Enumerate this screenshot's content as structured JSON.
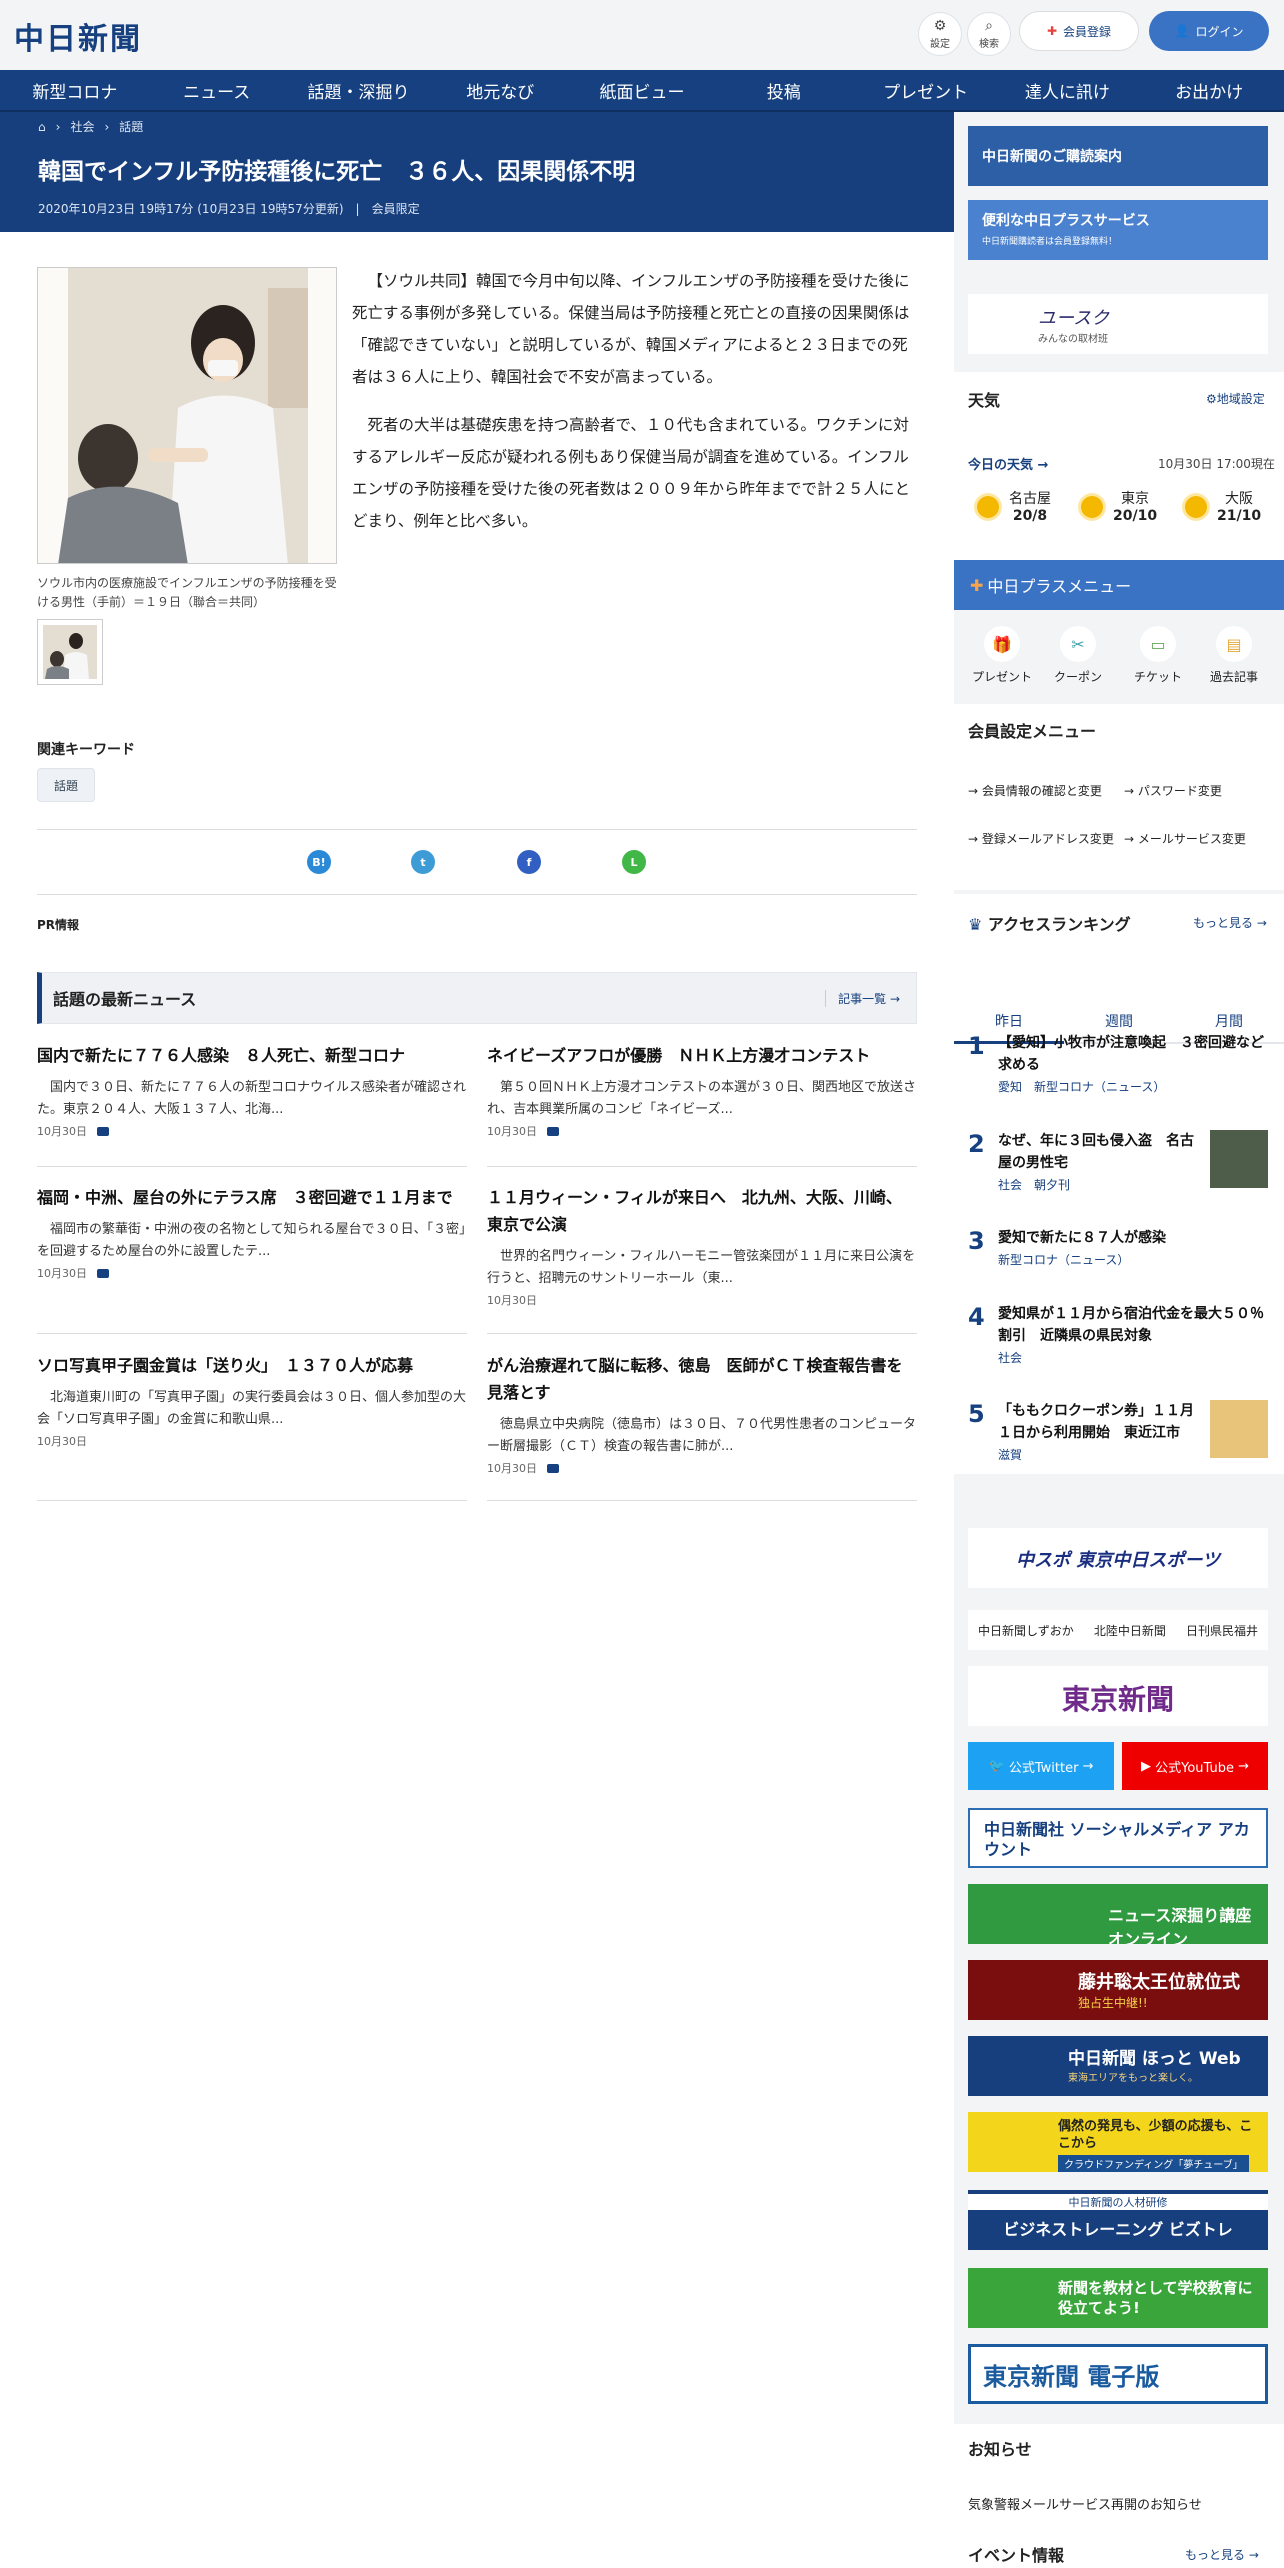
{
  "header": {
    "logo": "中日新聞",
    "settings_label": "設定",
    "search_label": "検索",
    "register_label": "会員登録",
    "login_label": "ログイン"
  },
  "nav": [
    "新型コロナ",
    "ニュース",
    "話題・深掘り",
    "地元なび",
    "紙面ビュー",
    "投稿",
    "プレゼント",
    "達人に訊け",
    "お出かけ"
  ],
  "breadcrumb": [
    "社会",
    "話題"
  ],
  "article": {
    "title": "韓国でインフル予防接種後に死亡　３６人、因果関係不明",
    "date": "2020年10月23日 19時17分 (10月23日 19時57分更新)",
    "member": "会員限定",
    "caption": "ソウル市内の医療施設でインフルエンザの予防接種を受ける男性（手前）＝１９日（聯合＝共同）",
    "p1": "【ソウル共同】韓国で今月中旬以降、インフルエンザの予防接種を受けた後に死亡する事例が多発している。保健当局は予防接種と死亡との直接の因果関係は「確認できていない」と説明しているが、韓国メディアによると２３日までの死者は３６人に上り、韓国社会で不安が高まっている。",
    "p2": "死者の大半は基礎疾患を持つ高齢者で、１０代も含まれている。ワクチンに対するアレルギー反応が疑われる例もあり保健当局が調査を進めている。インフルエンザの予防接種を受けた後の死者数は２００９年から昨年までで計２５人にとどまり、例年と比べ多い。",
    "keyword_heading": "関連キーワード",
    "keyword": "話題",
    "pr": "PR情報"
  },
  "latest": {
    "heading": "話題の最新ニュース",
    "more": "記事一覧",
    "items": [
      {
        "title": "国内で新たに７７６人感染　８人死亡、新型コロナ",
        "lead": "国内で３０日、新たに７７６人の新型コロナウイルス感染者が確認された。東京２０４人、大阪１３７人、北海...",
        "date": "10月30日"
      },
      {
        "title": "ネイビーズアフロが優勝　ＮＨＫ上方漫才コンテスト",
        "lead": "第５０回ＮＨＫ上方漫才コンテストの本選が３０日、関西地区で放送され、吉本興業所属のコンビ「ネイビーズ...",
        "date": "10月30日"
      },
      {
        "title": "福岡・中洲、屋台の外にテラス席　３密回避で１１月まで",
        "lead": "福岡市の繁華街・中洲の夜の名物として知られる屋台で３０日、「３密」を回避するため屋台の外に設置したテ...",
        "date": "10月30日"
      },
      {
        "title": "１１月ウィーン・フィルが来日へ　北九州、大阪、川崎、東京で公演",
        "lead": "世界的名門ウィーン・フィルハーモニー管弦楽団が１１月に来日公演を行うと、招聘元のサントリーホール（東...",
        "date": "10月30日"
      },
      {
        "title": "ソロ写真甲子園金賞は「送り火」　１３７０人が応募",
        "lead": "北海道東川町の「写真甲子園」の実行委員会は３０日、個人参加型の大会「ソロ写真甲子園」の金賞に和歌山県...",
        "date": "10月30日"
      },
      {
        "title": "がん治療遅れて脳に転移、徳島　医師がＣＴ検査報告書を見落とす",
        "lead": "徳島県立中央病院（徳島市）は３０日、７０代男性患者のコンピューター断層撮影（ＣＴ）検査の報告書に肺が...",
        "date": "10月30日"
      }
    ]
  },
  "sidebar": {
    "banner1": "中日新聞のご購読案内",
    "banner2": "便利な中日プラスサービス",
    "banner2_sub": "中日新聞購読者は会員登録無料！",
    "banner3": "ユースク",
    "banner3_sub": "みんなの取材班",
    "weather_heading": "天気",
    "weather_region": "地域設定",
    "weather_today": "今日の天気",
    "weather_time": "10月30日 17:00現在",
    "weather": [
      {
        "city": "名古屋",
        "temp": "20/8"
      },
      {
        "city": "東京",
        "temp": "20/10"
      },
      {
        "city": "大阪",
        "temp": "21/10"
      }
    ],
    "plus_menu": "中日プラスメニュー",
    "plus_items": [
      "プレゼント",
      "クーポン",
      "チケット",
      "過去記事"
    ],
    "member_heading": "会員設定メニュー",
    "member_links": [
      "会員情報の確認と変更",
      "パスワード変更",
      "登録メールアドレス変更",
      "メールサービス変更"
    ],
    "ranking_heading": "アクセスランキング",
    "ranking_more": "もっと見る",
    "ranking_tabs": [
      "昨日",
      "週間",
      "月間"
    ],
    "ranking": [
      {
        "n": "1",
        "title": "【愛知】小牧市が注意喚起　３密回避など求める",
        "tag": "愛知　新型コロナ（ニュース）"
      },
      {
        "n": "2",
        "title": "なぜ、年に３回も侵入盗　名古屋の男性宅",
        "tag": "社会　朝夕刊"
      },
      {
        "n": "3",
        "title": "愛知で新たに８７人が感染",
        "tag": "新型コロナ（ニュース）"
      },
      {
        "n": "4",
        "title": "愛知県が１１月から宿泊代金を最大５０％割引　近隣県の県民対象",
        "tag": "社会"
      },
      {
        "n": "5",
        "title": "「ももクロクーポン券」１１月１日から利用開始　東近江市",
        "tag": "滋賀"
      }
    ],
    "chuspo": "中スポ 東京中日スポーツ",
    "papers": [
      "中日新聞しずおか",
      "北陸中日新聞",
      "日刊県民福井"
    ],
    "tokyo": "東京新聞",
    "twitter": "公式Twitter",
    "youtube": "公式YouTube",
    "social": "中日新聞社 ソーシャルメディア アカウント",
    "fukabori": "ニュース深掘り講座 オンライン",
    "fujii": "藤井聡太王位就位式",
    "fujii_sub": "独占生中継!!",
    "hotto": "中日新聞 ほっと Web",
    "hotto_sub": "東海エリアをもっと楽しく。",
    "yume": "偶然の発見も、少額の応援も、ここから",
    "yume_sub": "クラウドファンディング「夢チューブ」",
    "bizu": "ビジネストレーニング ビズトレ",
    "bizu_top": "中日新聞の人材研修",
    "nie": "新聞を教材として学校教育に役立てよう!",
    "tokyo_e": "東京新聞 電子版",
    "notice_heading": "お知らせ",
    "notice_item": "気象警報メールサービス再開のお知らせ",
    "event_heading": "イベント情報",
    "event_more": "もっと見る"
  },
  "colors": {
    "navy": "#16407f",
    "blue": "#3a72c4"
  }
}
